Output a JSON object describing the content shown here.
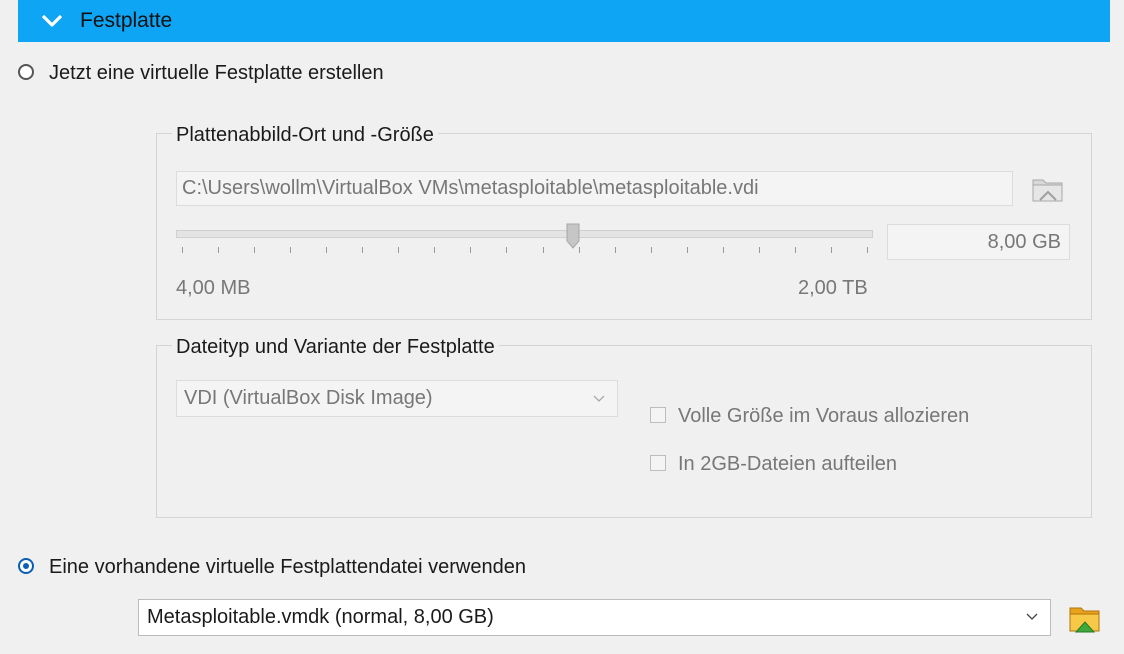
{
  "header": {
    "title": "Festplatte"
  },
  "option_create": {
    "label": "Jetzt eine virtuelle Festplatte erstellen",
    "checked": false
  },
  "location_group": {
    "title": "Plattenabbild-Ort und -Größe",
    "path": "C:\\Users\\wollm\\VirtualBox VMs\\metasploitable\\metasploitable.vdi",
    "size_value": "8,00 GB",
    "slider_min_label": "4,00 MB",
    "slider_max_label": "2,00 TB",
    "slider_position": 0.57
  },
  "type_group": {
    "title": "Dateityp und Variante der Festplatte",
    "format_selected": "VDI (VirtualBox Disk Image)",
    "prealloc_label": "Volle Größe im Voraus allozieren",
    "split_label": "In 2GB-Dateien aufteilen"
  },
  "option_existing": {
    "label": "Eine vorhandene virtuelle Festplattendatei verwenden",
    "checked": true,
    "selected_file": "Metasploitable.vmdk (normal, 8,00 GB)"
  },
  "colors": {
    "header": "#0ea5f5",
    "radio_checked": "#0a5fb4"
  }
}
